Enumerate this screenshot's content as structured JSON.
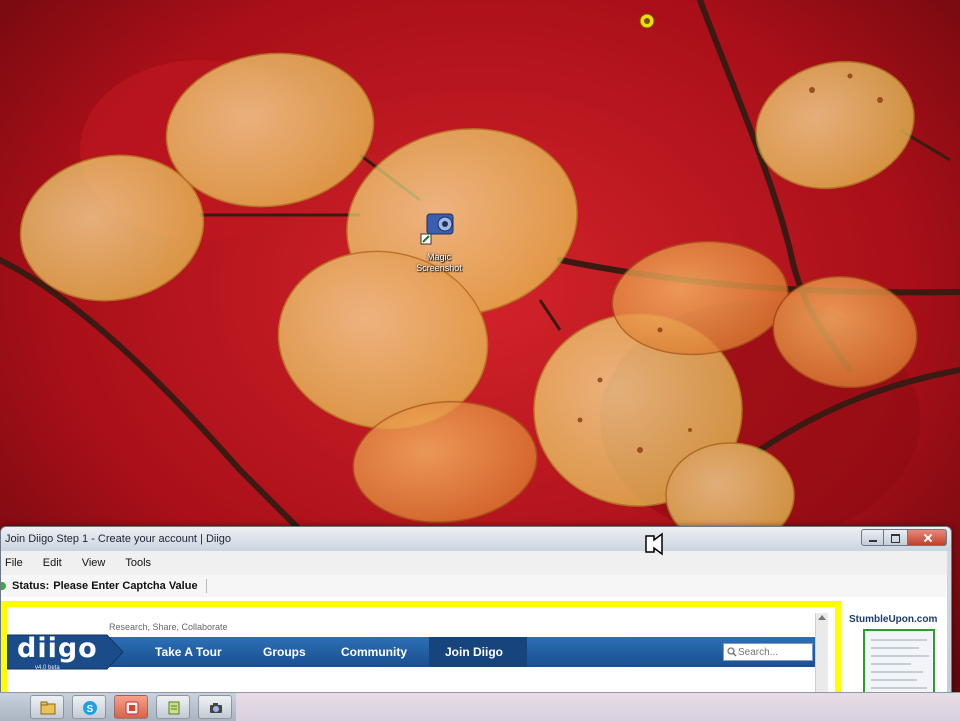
{
  "desktop": {
    "icon": {
      "name": "magic-screenshot-icon",
      "label": "Magic Screenshot"
    }
  },
  "window": {
    "title": "Join Diigo Step 1 - Create your account | Diigo",
    "menu": [
      "File",
      "Edit",
      "View",
      "Tools"
    ],
    "status": {
      "label": "Status:",
      "text": "Please Enter Captcha Value"
    }
  },
  "diigo": {
    "tagline": "Research, Share, Collaborate",
    "logo": "diigo",
    "logo_sub": "v4.0 beta",
    "nav": [
      "Take A Tour",
      "Groups",
      "Community",
      "Join Diigo"
    ],
    "search_placeholder": "Search..."
  },
  "side_panel": {
    "label": "StumbleUpon.com"
  },
  "taskbar": {
    "buttons": [
      "windows-explorer-icon",
      "skype-icon",
      "office-app-icon",
      "notepad-icon",
      "camera-icon"
    ]
  },
  "colors": {
    "frame_highlight": "#ffff00",
    "diigo_nav": "#1f5a9e",
    "wallpaper_red": "#b5101a",
    "leaf_yellow": "#f5e27a",
    "leaf_orange": "#e9953f"
  }
}
